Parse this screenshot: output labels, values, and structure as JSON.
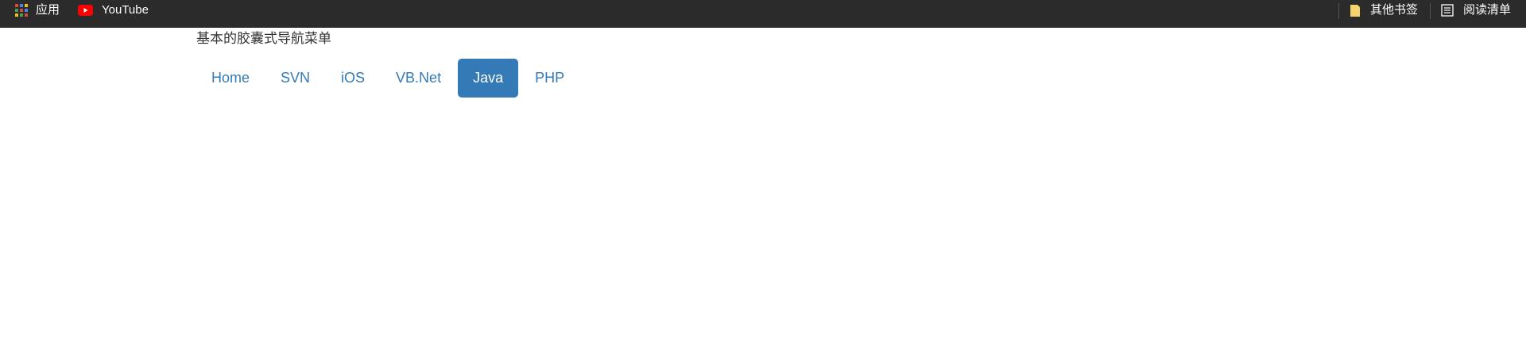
{
  "bookmarks_bar": {
    "apps_label": "应用",
    "youtube_label": "YouTube",
    "other_bookmarks_label": "其他书签",
    "reading_list_label": "阅读清单",
    "youtube_color": "#ff0000",
    "folder_color": "#f6d36b",
    "icons": [
      "apps-grid-icon",
      "youtube-icon",
      "folder-icon",
      "reading-list-icon"
    ]
  },
  "main": {
    "heading": "基本的胶囊式导航菜单",
    "nav_pills": [
      {
        "label": "Home",
        "active": false
      },
      {
        "label": "SVN",
        "active": false
      },
      {
        "label": "iOS",
        "active": false
      },
      {
        "label": "VB.Net",
        "active": false
      },
      {
        "label": "Java",
        "active": true
      },
      {
        "label": "PHP",
        "active": false
      }
    ],
    "accent_color": "#337ab7"
  }
}
